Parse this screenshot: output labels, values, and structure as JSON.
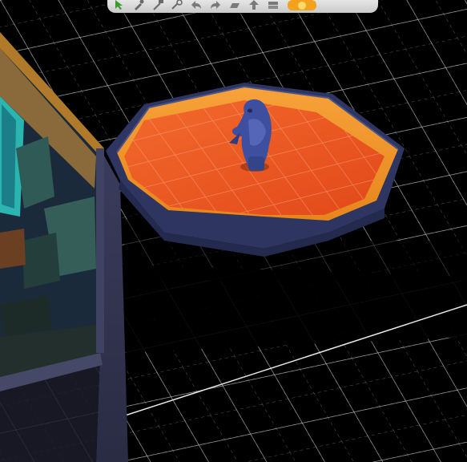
{
  "scene": {
    "view": "build-mode-3d",
    "grid_color": "#ffffff",
    "platform": {
      "shape": "octagon",
      "floor_color": "#ef5a22",
      "wall_color": "#2d3560"
    },
    "statue": {
      "name": "blue-fish-statue-icon",
      "color": "#3d4f9e"
    },
    "room": {
      "wall_color": "#2a2e4a",
      "trim_color": "#b07a2a"
    }
  },
  "toolbar": {
    "buttons": [
      {
        "name": "select-arrow-icon",
        "color": "#3a9a2a"
      },
      {
        "name": "eyedropper-icon",
        "color": "#6a6a6a"
      },
      {
        "name": "sledgehammer-icon",
        "color": "#6a6a6a"
      },
      {
        "name": "design-tool-icon",
        "color": "#6a6a6a"
      },
      {
        "name": "undo-icon",
        "color": "#7a7a7a"
      },
      {
        "name": "redo-icon",
        "color": "#7a7a7a"
      },
      {
        "name": "floor-level-icon",
        "color": "#7a7a7a"
      },
      {
        "name": "move-up-level-icon",
        "color": "#7a7a7a"
      },
      {
        "name": "wall-view-icon",
        "color": "#7a7a7a"
      },
      {
        "name": "lighting-toggle-icon",
        "color": "#f2a21c"
      }
    ]
  }
}
